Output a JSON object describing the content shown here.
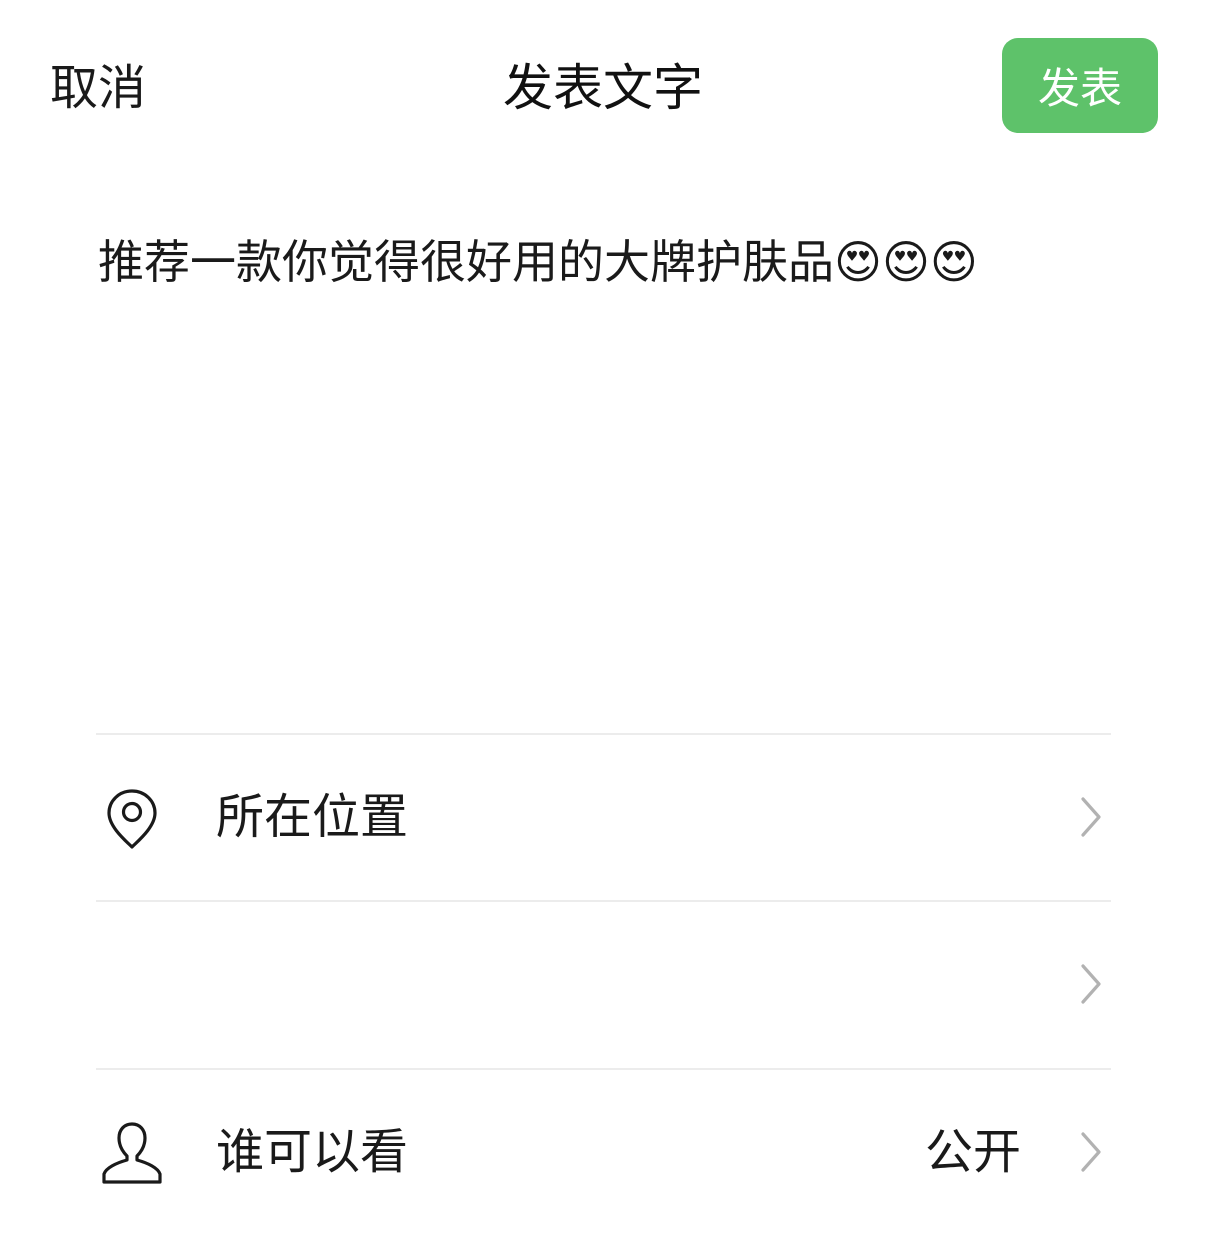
{
  "nav": {
    "cancel_label": "取消",
    "title": "发表文字",
    "publish_label": "发表"
  },
  "compose": {
    "text": "推荐一款你觉得很好用的大牌护肤品😍😍😍"
  },
  "options": {
    "location": {
      "label": "所在位置",
      "icon": "location-pin-icon"
    },
    "blank": {
      "label": ""
    },
    "visibility": {
      "label": "谁可以看",
      "value": "公开",
      "icon": "person-icon"
    }
  },
  "colors": {
    "accent": "#5ec26a",
    "divider": "#ececec",
    "chevron": "#b2b2b2"
  }
}
